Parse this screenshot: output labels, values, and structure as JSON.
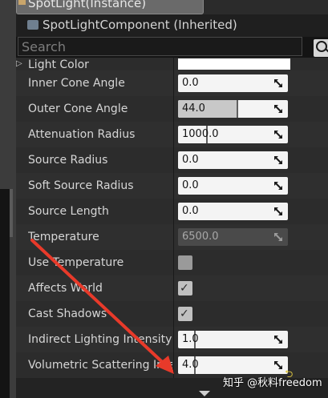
{
  "header": {
    "actor_label": "SpotLight(Instance)",
    "component_label": "SpotLightComponent (Inherited)"
  },
  "search": {
    "placeholder": "Search"
  },
  "properties": [
    {
      "label": "Light Color",
      "kind": "color",
      "color": "#ffffff"
    },
    {
      "label": "Inner Cone Angle",
      "kind": "number",
      "value": "0.0"
    },
    {
      "label": "Outer Cone Angle",
      "kind": "number",
      "value": "44.0"
    },
    {
      "label": "Attenuation Radius",
      "kind": "number",
      "value": "1000.0"
    },
    {
      "label": "Source Radius",
      "kind": "number",
      "value": "0.0"
    },
    {
      "label": "Soft Source Radius",
      "kind": "number",
      "value": "0.0"
    },
    {
      "label": "Source Length",
      "kind": "number",
      "value": "0.0"
    },
    {
      "label": "Temperature",
      "kind": "number",
      "value": "6500.0",
      "disabled": true
    },
    {
      "label": "Use Temperature",
      "kind": "check",
      "checked": false
    },
    {
      "label": "Affects World",
      "kind": "check",
      "checked": true
    },
    {
      "label": "Cast Shadows",
      "kind": "check",
      "checked": true
    },
    {
      "label": "Indirect Lighting Intensity",
      "kind": "number",
      "value": "1.0"
    },
    {
      "label": "Volumetric Scattering Intensity",
      "kind": "number",
      "value": "4.0"
    }
  ],
  "watermark": "知乎 @秋料freedom",
  "colors": {
    "annotation_arrow": "#e83a2a",
    "panel_bg": "#2c2c2c"
  }
}
